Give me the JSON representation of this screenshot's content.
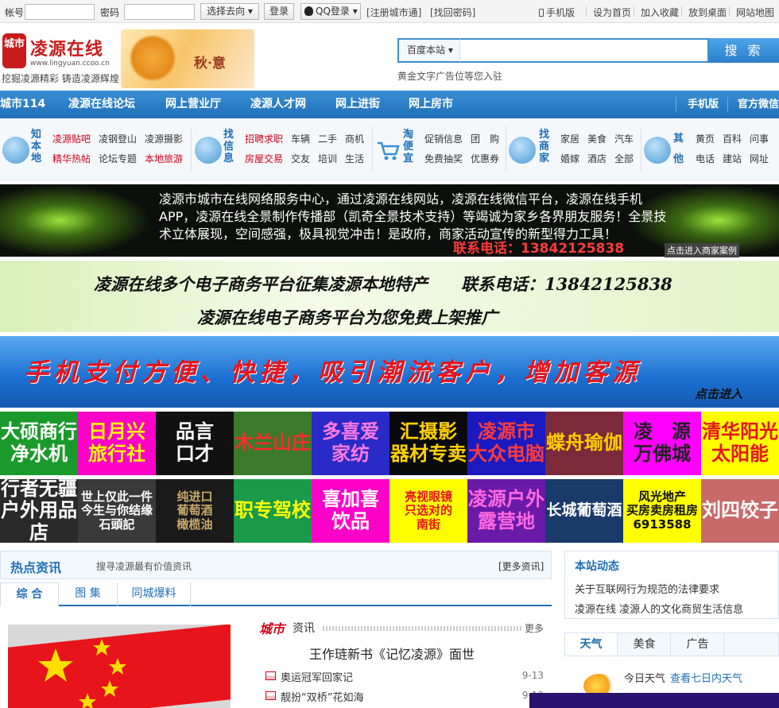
{
  "topbar": {
    "account_label": "帐号",
    "password_label": "密码",
    "go_select": "选择去向",
    "login_button": "登录",
    "qq_login": "QQ登录",
    "register": "[注册城市通]",
    "find_password": "[找回密码]",
    "mobile": "手机版",
    "set_home": "设为首页",
    "add_fav": "加入收藏",
    "to_desktop": "放到桌面",
    "site_map": "网站地图"
  },
  "header": {
    "logo_mark": "城市",
    "logo_name": "凌源在线",
    "logo_url": "www.lingyuan.ccoo.cn",
    "slogan": "挖掘凌源精彩 铸造凌源辉煌",
    "autumn_text": "秋·意",
    "search_scope": "百度本站 ▾",
    "search_button": "搜 索",
    "ad_text": "黄金文字广告位等您入驻"
  },
  "mainnav": {
    "items": [
      "城市114",
      "凌源在线论坛",
      "网上营业厅",
      "凌源人才网",
      "网上进街",
      "网上房市"
    ],
    "right_items": [
      "手机版",
      "官方微信"
    ]
  },
  "categories": {
    "local": {
      "title": "知本地",
      "links": [
        "凌源贴吧",
        "凌钢登山",
        "凌源摄影",
        "精华热帖",
        "论坛专题",
        "本地旅游"
      ]
    },
    "info": {
      "title": "找信息",
      "links": [
        "招聘求职",
        "车辆",
        "二手",
        "商机",
        "房屋交易",
        "交友",
        "培训",
        "生活"
      ]
    },
    "deal": {
      "title": "淘便宜",
      "links": [
        "促销信息",
        "团　购",
        "免费抽奖",
        "优惠券"
      ]
    },
    "biz": {
      "title": "找商家",
      "links": [
        "家居",
        "美食",
        "汽车",
        "婚嫁",
        "酒店",
        "全部"
      ]
    },
    "other": {
      "title": "其他",
      "links": [
        "黄页",
        "百科",
        "问事",
        "电话",
        "建站",
        "网址"
      ]
    }
  },
  "banners": {
    "b1_text": "凌源市城市在线网络服务中心，通过凌源在线网站，凌源在线微信平台，凌源在线手机APP，凌源在线全景制作传播部（凯奇全景技术支持）等竭诚为家乡各界朋友服务！全景技术立体展现，空间感强，极具视觉冲击！是政府，商家活动宣传的新型得力工具！",
    "b1_phone": "联系电话：13842125838",
    "b1_link": "点击进入商家案例",
    "b2_line1": "凌源在线多个电子商务平台征集凌源本地特产　　联系电话：13842125838",
    "b2_line2": "凌源在线电子商务平台为您免费上架推广",
    "b3_text": "手机支付方便、快捷，吸引潮流客户，增加客源",
    "b3_link": "点击进入"
  },
  "tiles_row1": [
    {
      "text": "大硕商行\n净水机",
      "bg": "#1a9a2a",
      "fg": "#ffffff"
    },
    {
      "text": "日月兴\n旅行社",
      "bg": "#ff00c8",
      "fg": "#ffff00"
    },
    {
      "text": "品言\n口才",
      "bg": "#111111",
      "fg": "#ffffff"
    },
    {
      "text": "木兰山庄",
      "bg": "#3a7a2a",
      "fg": "#ff2a2a"
    },
    {
      "text": "多喜爱\n家纺",
      "bg": "#2a2ac8",
      "fg": "#ff7ae0"
    },
    {
      "text": "汇摄影\n器材专卖",
      "bg": "#0a0a0a",
      "fg": "#ffd200"
    },
    {
      "text": "凌源市\n大众电脑",
      "bg": "#1a1ac0",
      "fg": "#ff3b3b"
    },
    {
      "text": "蝶舟瑜伽",
      "bg": "#7a2a3a",
      "fg": "#ffcc00"
    },
    {
      "text": "凌　源\n万佛城",
      "bg": "#ff00ff",
      "fg": "#222222"
    },
    {
      "text": "清华阳光\n太阳能",
      "bg": "#ffff00",
      "fg": "#e8141b"
    }
  ],
  "tiles_row2": [
    {
      "text": "行者无疆\n户外用品店",
      "bg": "#2a2a2a",
      "fg": "#ffffff"
    },
    {
      "text": "世上仅此一件\n今生与你结缘\n石頭記",
      "bg": "#3a3a3a",
      "fg": "#ffffff"
    },
    {
      "text": "纯进口\n葡萄酒\n橄榄油",
      "bg": "#1a1a1a",
      "fg": "#c8a86a"
    },
    {
      "text": "职专驾校",
      "bg": "#1a9a4a",
      "fg": "#ffff00"
    },
    {
      "text": "喜加喜\n饮品",
      "bg": "#ff00c8",
      "fg": "#ffffff"
    },
    {
      "text": "亮视眼镜\n只选对的\n南街",
      "bg": "#ffff00",
      "fg": "#e8141b"
    },
    {
      "text": "凌源户外\n露营地",
      "bg": "#6a1aa8",
      "fg": "#ff6ae0"
    },
    {
      "text": "长城葡萄酒",
      "bg": "#1a3a6a",
      "fg": "#ffffff"
    },
    {
      "text": "风光地产\n买房卖房租房\n6913588",
      "bg": "#ffff00",
      "fg": "#111111"
    },
    {
      "text": "刘四饺子",
      "bg": "#c86a6a",
      "fg": "#ffffff"
    }
  ],
  "hotnews": {
    "title": "热点资讯",
    "subtitle": "搜寻凌源最有价值资讯",
    "more": "[更多资讯]",
    "tabs": [
      "综 合",
      "图 集",
      "同城爆料"
    ]
  },
  "citynews": {
    "title_a": "城市",
    "title_b": "资讯",
    "more": "更多",
    "lead": "王作琏新书《记忆凌源》面世",
    "items": [
      {
        "title": "奥运冠军回家记",
        "date": "9-13"
      },
      {
        "title": "靓扮“双桥”花如海",
        "date": "9-13"
      }
    ]
  },
  "sidebar": {
    "title": "本站动态",
    "links": [
      "关于互联网行为规范的法律要求",
      "凌源在线 凌源人的文化商贸生活信息"
    ],
    "tabs": [
      "天气",
      "美食",
      "广告"
    ],
    "today_weather": "今日天气",
    "week_weather": "查看七日内天气"
  }
}
